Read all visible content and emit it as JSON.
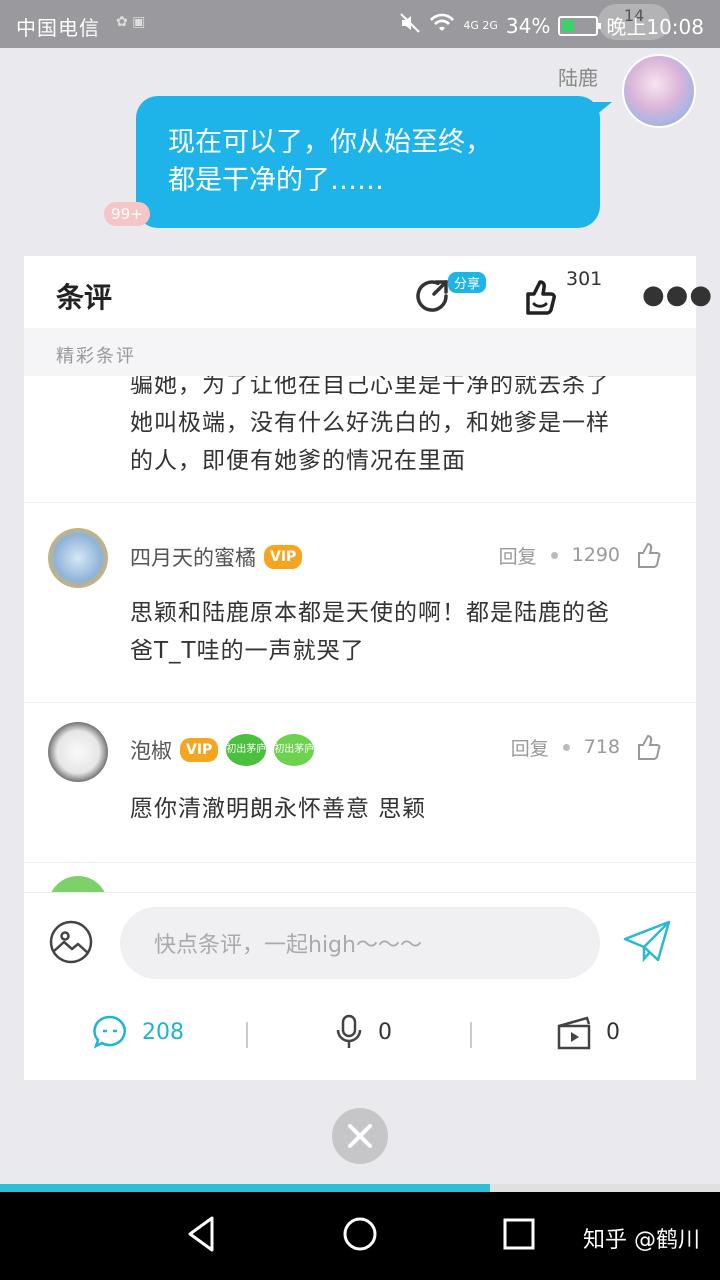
{
  "status_bar": {
    "carrier": "中国电信",
    "network": "4G 2G",
    "battery": "34%",
    "time": "晚上10:08",
    "bubble_count": "14"
  },
  "chat": {
    "sender_name": "陆鹿",
    "message_line1": "现在可以了，你从始至终，",
    "message_line2": "都是干净的了……",
    "badge": "99+"
  },
  "panel": {
    "title": "条评",
    "share_tag": "分享",
    "like_count": "301",
    "section_label": "精彩条评"
  },
  "comments": [
    {
      "text_line1": "骗她，为了让他在自己心里是干净的就去杀了",
      "text_line2": "她叫极端，没有什么好洗白的，和她爹是一样",
      "text_line3": "的人，即便有她爹的情况在里面"
    },
    {
      "username": "四月天的蜜橘",
      "vip": "VIP",
      "reply": "回复",
      "likes": "1290",
      "text_line1": "思颖和陆鹿原本都是天使的啊！都是陆鹿的爸",
      "text_line2": "爸T_T哇的一声就哭了"
    },
    {
      "username": "泡椒",
      "vip": "VIP",
      "medal1": "初出茅庐",
      "medal2": "初出茅庐",
      "reply": "回复",
      "likes": "718",
      "text_line1": "愿你清澈明朗永怀善意 思颖"
    }
  ],
  "input": {
    "placeholder": "快点条评，一起high～～～"
  },
  "stats": {
    "comments": "208",
    "voice": "0",
    "video": "0"
  },
  "progress": 0.68,
  "watermark": "知乎 @鹤川",
  "colors": {
    "accent": "#1fb4e9",
    "teal": "#1fb4d0",
    "vip": "#f4a623"
  }
}
